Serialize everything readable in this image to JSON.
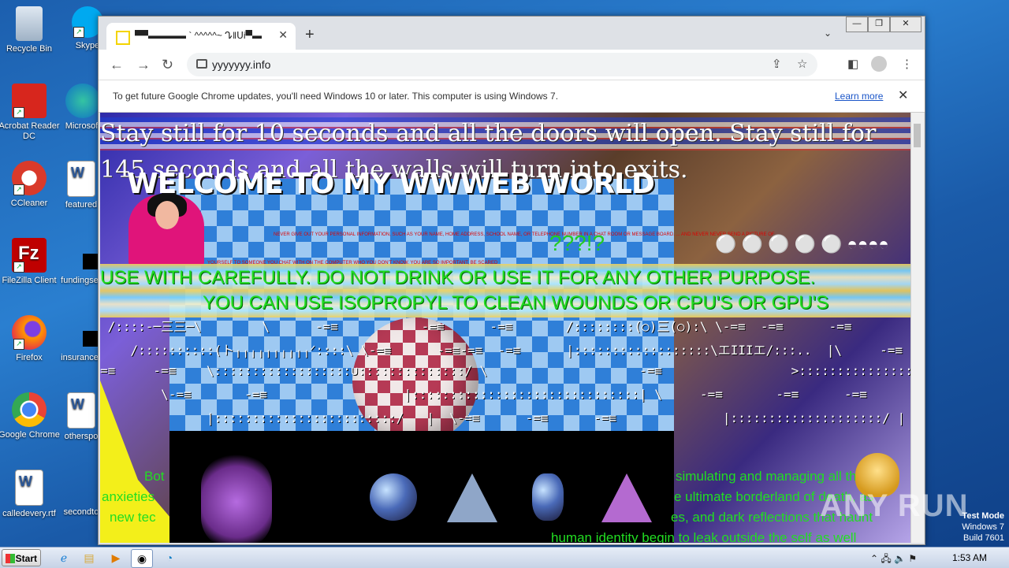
{
  "desktop": {
    "icons": [
      {
        "label": "Recycle Bin"
      },
      {
        "label": "Skype"
      },
      {
        "label": "Acrobat Reader DC"
      },
      {
        "label": "Microsoft"
      },
      {
        "label": "CCleaner"
      },
      {
        "label": "featured"
      },
      {
        "label": "FileZilla Client"
      },
      {
        "label": "fundingse"
      },
      {
        "label": "Firefox"
      },
      {
        "label": "insurance"
      },
      {
        "label": "Google Chrome"
      },
      {
        "label": "otherspo"
      },
      {
        "label": "calledevery.rtf"
      },
      {
        "label": "secondto"
      }
    ]
  },
  "browser": {
    "tab_title": "▀▀▬▬▬▬ ` ^^^^^~ ᖊ‖ᑌi▀▬",
    "url": "yyyyyyy.info",
    "infobar_message": "To get future Google Chrome updates, you'll need Windows 10 or later. This computer is using Windows 7.",
    "infobar_link": "Learn more",
    "window_controls": [
      "—",
      "❐",
      "✕"
    ]
  },
  "page": {
    "stay_line1": "Stay still for 10 seconds and all the doors will open. Stay still for",
    "stay_line2": "145 seconds and all the walls will turn into exits.",
    "welcome": "WELCOME TO MY WWWEB WORLD",
    "warning1": "NEVER GIVE OUT YOUR PERSONAL INFORMATION, SUCH AS YOUR NAME, HOME ADDRESS, SCHOOL NAME, OR TELEPHONE NUMBER IN A CHAT ROOM OR MESSAGE BOARD. ... AND NEVER NEVER SEND A PICTURE OF",
    "warning2": "YOURSELF TO SOMEONE YOU CHAT WITH ON THE COMPUTER WHO YOU DON'T KNOW. YOU ARE SO IMPORTANT, BE SCARED",
    "question_marks": "???!?",
    "green_line1": "USE WITH CAREFULLY. DO NOT DRINK OR USE IT FOR ANY OTHER PURPOSE.",
    "green_line2": "YOU CAN USE ISOPROPYL TO CLEAN WOUNDS OR CPU'S OR GPU'S",
    "ascii_lines": [
      " /::::-─三三─\\        \\      -=≡           -=≡      -=≡       /::::::::(○)三(○):\\ \\-=≡  -=≡      -=≡",
      "    /::::::::::(ト╷╷╷╷╷╷╷╷╷╷ᐟ::::\\ \\-=≡      -=≡-=≡  -=≡      |::::::::::::::::::\\エIIIエ/:::..  |\\     -=≡       -",
      "=≡     -=≡    \\::::::::::::::::::∪::::::::::::::/ \\                    -=≡                 >::::::::::::::::::::::::::::::<",
      "        \\-=≡       -=≡                  |::::::::::::::::::::::::::::::| \\     -=≡       -=≡      -=≡",
      "              |::::::::::::::::::::::::/   |  \\-=≡      -=≡      -=≡              |::::::::::::::::::::/ |  |"
    ],
    "low_line1": "Bot",
    "low_line2": "anxieties",
    "low_line3": "new tec",
    "right_line1": "simulating and managing all the",
    "right_line2": "e ultimate borderland of death, as",
    "right_line3": "es, and dark reflections that haunt",
    "right_line4": "human identity begin to leak outside the self as well"
  },
  "watermark": {
    "brand": "ANY RUN",
    "mode": "Test Mode",
    "os": "Windows 7",
    "build": "Build 7601"
  },
  "taskbar": {
    "start_label": "Start",
    "clock": "1:53 AM"
  },
  "colors": {
    "accent_green": "#22dd22",
    "desktop_blue": "#1c5fae",
    "warning_red": "#dd0000"
  }
}
